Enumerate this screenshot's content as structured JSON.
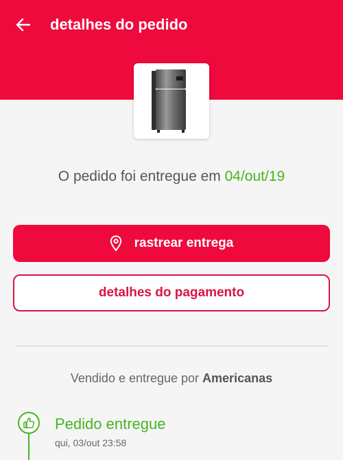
{
  "colors": {
    "brand": "#ee0a3c",
    "accent_green": "#46b51e",
    "outline_red": "#d81544"
  },
  "header": {
    "back_icon": "arrow-left-icon",
    "title": "detalhes do pedido"
  },
  "product": {
    "image": "refrigerator-image"
  },
  "status": {
    "prefix": "O pedido foi entregue em ",
    "date": "04/out/19"
  },
  "actions": {
    "track_icon": "location-pin-icon",
    "track_label": "rastrear entrega",
    "payment_label": "detalhes do pagamento"
  },
  "seller": {
    "prefix": "Vendido e entregue por ",
    "name": "Americanas"
  },
  "timeline": {
    "events": [
      {
        "icon": "thumbs-up-icon",
        "title": "Pedido entregue",
        "time": "qui, 03/out 23:58"
      }
    ]
  }
}
